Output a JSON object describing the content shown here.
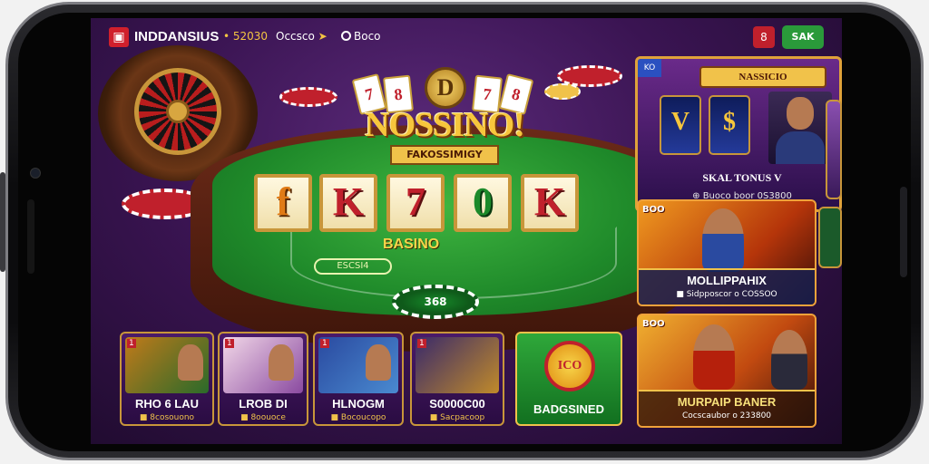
{
  "topbar": {
    "logo_glyph": "▣",
    "app_name": "INDDANSIUS",
    "balance": "• 52030",
    "promo_label": "Occsco",
    "promo_icon": "arrow-icon",
    "bonus_label": "Boco",
    "message_button": "8",
    "action_button": "SAK"
  },
  "hero": {
    "title_cards": [
      "7",
      "8",
      "7",
      "8"
    ],
    "title_coin": "D",
    "title": "NOSSINO!",
    "subtitle": "FAKOSSIMIGY",
    "reels": [
      "f",
      "K",
      "7",
      "0",
      "K"
    ],
    "felt_label": "BASINO",
    "felt_pill": "ESCSI4",
    "felt_chip": "368"
  },
  "featured_panel": {
    "tag": "KO",
    "title": "NASSICIO",
    "tiles": [
      "V",
      "$"
    ],
    "name": "SKAL TONUS V",
    "sub": "⊕ Buoco boor 0S3800"
  },
  "promo_panels": [
    {
      "tag": "BOO",
      "title": "MOLLIPPAHIX",
      "sub": "■ Sidpposcor o COSSOO"
    },
    {
      "tag": "BOO",
      "title": "MURPAIP BANER",
      "sub": "Cocscaubor o 233800"
    }
  ],
  "game_cards": [
    {
      "tag": "1",
      "title": "RHO 6 LAU",
      "sub": "■ 8cosouono"
    },
    {
      "tag": "1",
      "title": "LROB DI",
      "sub": "■ 8oouoce"
    },
    {
      "tag": "1",
      "title": "HLNOGM",
      "sub": "■ Bocoucopo"
    },
    {
      "tag": "1",
      "title": "S0000C00",
      "sub": "■ Sacpacoop"
    }
  ],
  "green_card": {
    "badge": "ICO",
    "title": "BADGSINED"
  },
  "colors": {
    "accent": "#f0c24a",
    "felt": "#1f8a2a",
    "brand_red": "#c0202c"
  }
}
